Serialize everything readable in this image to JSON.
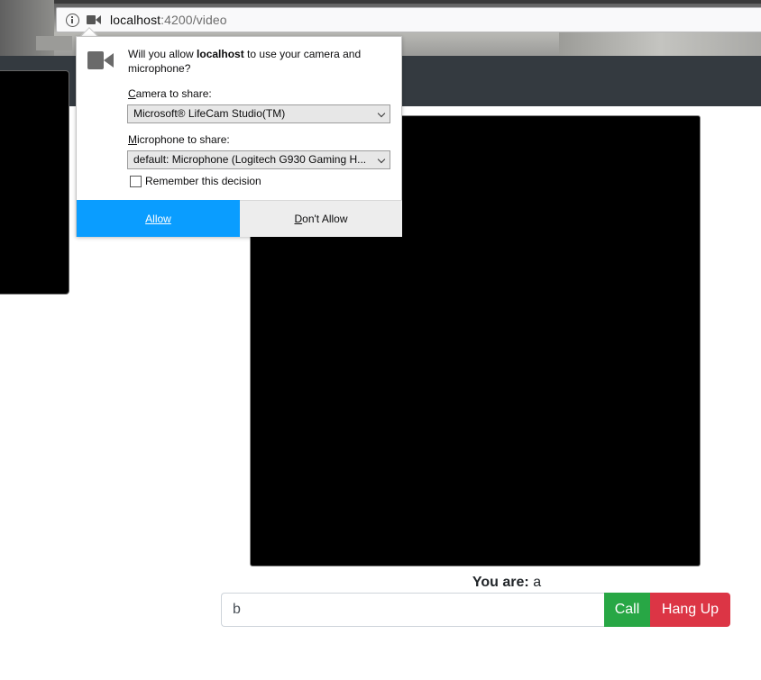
{
  "browser": {
    "url_host": "localhost",
    "url_path": ":4200/video"
  },
  "permission_popup": {
    "question_prefix": "Will you allow ",
    "question_host": "localhost",
    "question_suffix": " to use your camera and microphone?",
    "camera_label_accesskey": "C",
    "camera_label_rest": "amera to share:",
    "camera_selected": "Microsoft® LifeCam Studio(TM)",
    "mic_label_accesskey": "M",
    "mic_label_rest": "icrophone to share:",
    "mic_selected": "default: Microphone (Logitech G930 Gaming H...",
    "remember_label": "Remember this decision",
    "remember_checked": false,
    "allow_label": "Allow",
    "deny_accesskey": "D",
    "deny_rest": "on't Allow"
  },
  "call_panel": {
    "you_are_label": "You are:",
    "you_are_value": "a",
    "peer_input_value": "b",
    "call_label": "Call",
    "hangup_label": "Hang Up"
  },
  "colors": {
    "navbar": "#343a40",
    "allow_button": "#0a9dff",
    "call_button": "#28a745",
    "hangup_button": "#dc3545"
  }
}
